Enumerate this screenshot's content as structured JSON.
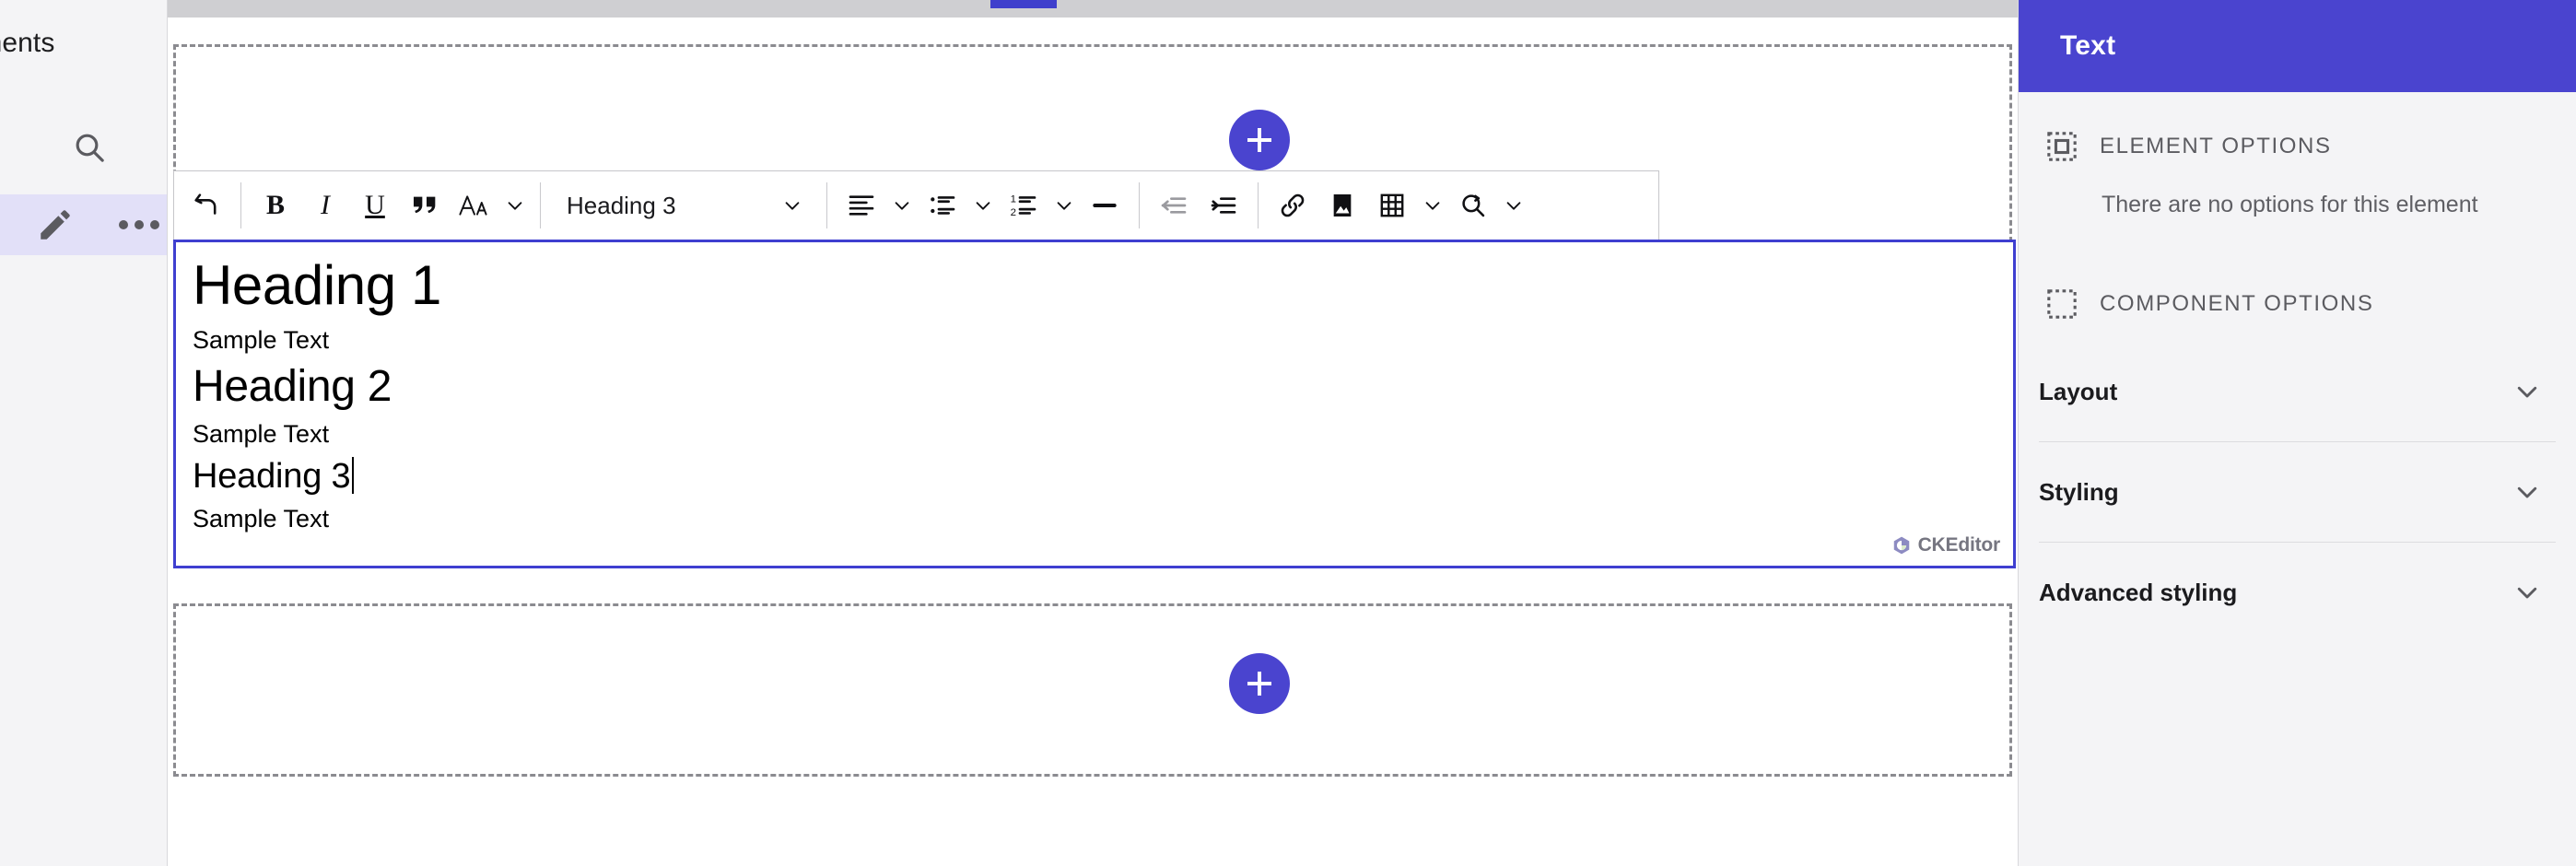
{
  "sidebar": {
    "title": "ponents",
    "search_icon": "search-icon",
    "selected_item": {
      "edit_icon": "pencil-icon",
      "more_icon": "more-horizontal-icon"
    }
  },
  "canvas": {
    "drop_zone_top": {
      "add_label": "+"
    },
    "drop_zone_bottom": {
      "add_label": "+"
    }
  },
  "toolbar": {
    "undo_label": "undo-icon",
    "bold_label": "B",
    "italic_label": "I",
    "underline_label": "U",
    "quote_label": "“",
    "font_label": "A",
    "heading_value": "Heading 3",
    "align_label": "align-icon",
    "bulleted_list_label": "bulleted-list-icon",
    "numbered_list_label": "numbered-list-icon",
    "horizontal_line_label": "horizontal-line-icon",
    "outdent_label": "outdent-icon",
    "indent_label": "indent-icon",
    "link_label": "link-icon",
    "image_label": "image-icon",
    "table_label": "table-icon",
    "find_replace_label": "find-replace-icon"
  },
  "document": {
    "blocks": [
      {
        "type": "h1",
        "text": "Heading 1"
      },
      {
        "type": "p",
        "text": "Sample Text"
      },
      {
        "type": "h2",
        "text": "Heading 2"
      },
      {
        "type": "p",
        "text": "Sample Text"
      },
      {
        "type": "h3",
        "text": "Heading 3"
      },
      {
        "type": "p",
        "text": "Sample Text"
      }
    ],
    "h1": "Heading 1",
    "p1": "Sample Text",
    "h2": "Heading 2",
    "p2": "Sample Text",
    "h3": "Heading 3",
    "p3": "Sample Text",
    "watermark": "CKEditor"
  },
  "right_panel": {
    "header_title": "Text",
    "element_options_label": "ELEMENT OPTIONS",
    "element_options_empty": "There are no options for this element",
    "component_options_label": "COMPONENT OPTIONS",
    "accordion": [
      {
        "label": "Layout"
      },
      {
        "label": "Styling"
      },
      {
        "label": "Advanced styling"
      }
    ]
  },
  "colors": {
    "accent_purple": "#4a44cf",
    "editor_border": "#3f3fd0",
    "selected_row": "#e2e0f8",
    "panel_bg": "#f4f4f6",
    "dashed_border": "#8b8b90"
  }
}
